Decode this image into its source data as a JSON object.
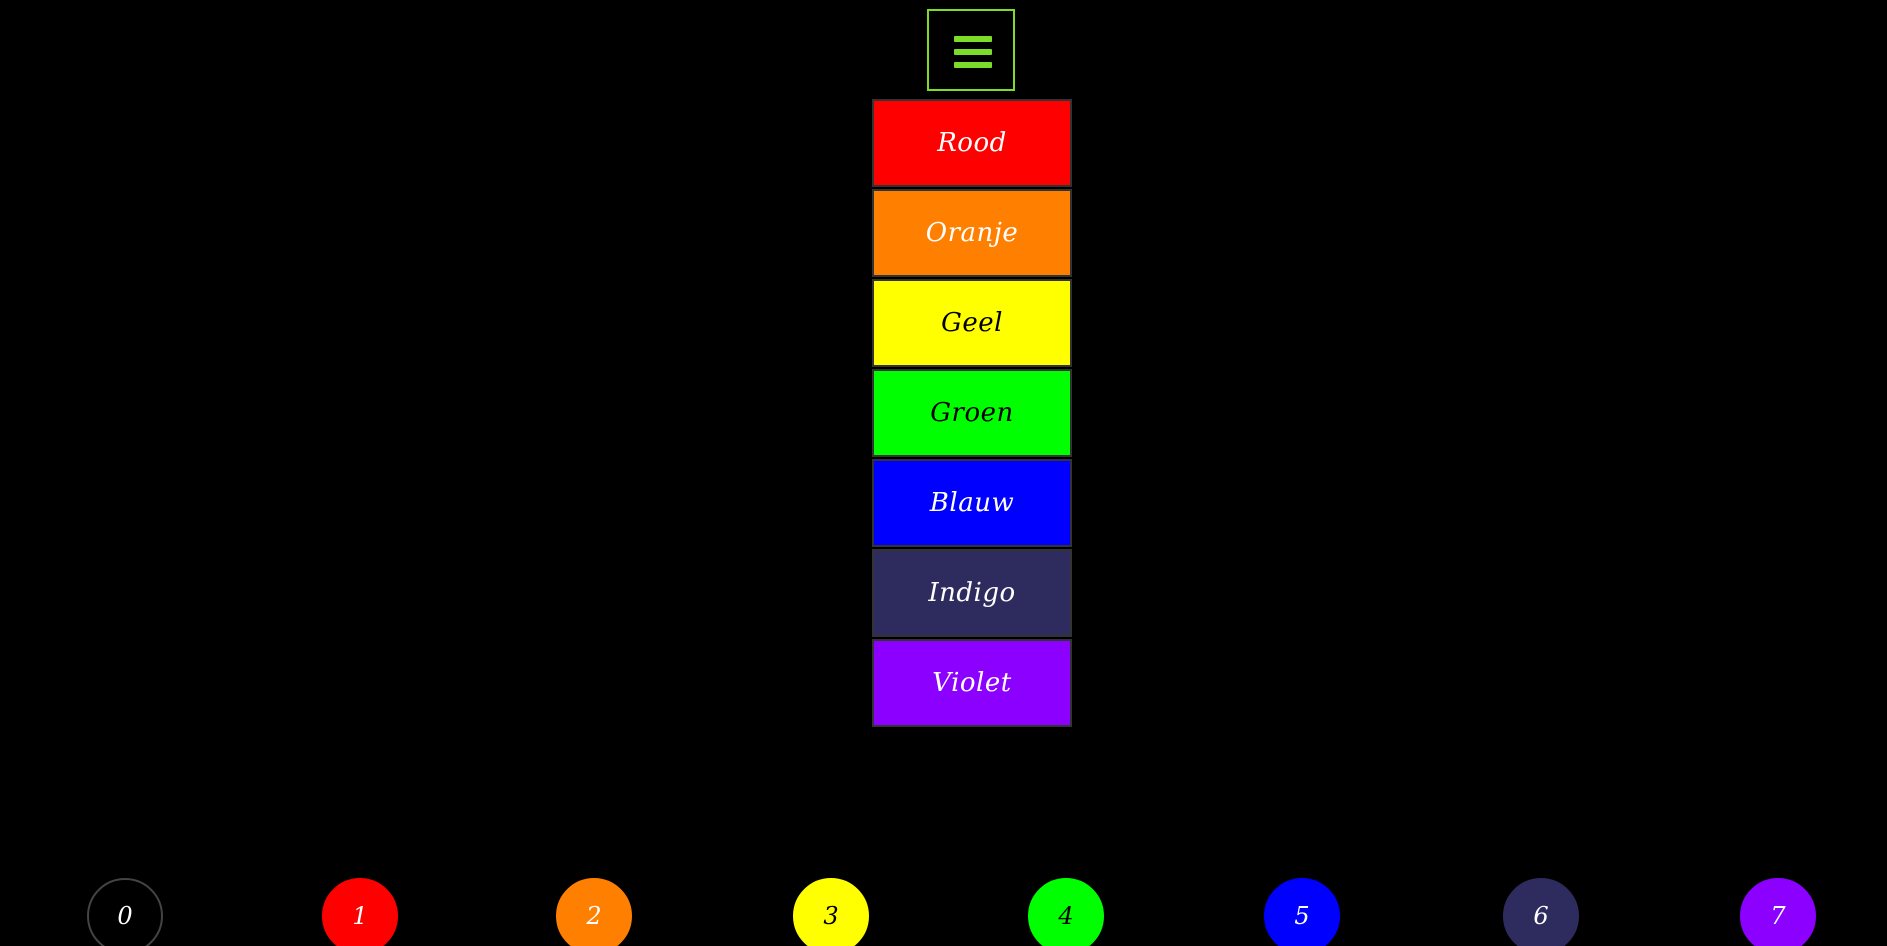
{
  "menu": {
    "icon": "hamburger-menu-icon",
    "color": "#7cdc2a"
  },
  "colors": [
    {
      "label": "Rood",
      "bg": "#ff0000",
      "fg": "#ffffff"
    },
    {
      "label": "Oranje",
      "bg": "#ff8000",
      "fg": "#ffffff"
    },
    {
      "label": "Geel",
      "bg": "#ffff00",
      "fg": "#000000"
    },
    {
      "label": "Groen",
      "bg": "#00ff00",
      "fg": "#000000"
    },
    {
      "label": "Blauw",
      "bg": "#0000ff",
      "fg": "#ffffff"
    },
    {
      "label": "Indigo",
      "bg": "#2e2b5f",
      "fg": "#ffffff"
    },
    {
      "label": "Violet",
      "bg": "#8b00ff",
      "fg": "#ffffff"
    }
  ],
  "circles": [
    {
      "label": "0",
      "bg": "#000000",
      "fg": "#ffffff",
      "border": "#444444"
    },
    {
      "label": "1",
      "bg": "#ff0000",
      "fg": "#ffffff",
      "border": "#ff0000"
    },
    {
      "label": "2",
      "bg": "#ff8000",
      "fg": "#ffffff",
      "border": "#ff8000"
    },
    {
      "label": "3",
      "bg": "#ffff00",
      "fg": "#000000",
      "border": "#ffff00"
    },
    {
      "label": "4",
      "bg": "#00ff00",
      "fg": "#000000",
      "border": "#00ff00"
    },
    {
      "label": "5",
      "bg": "#0000ff",
      "fg": "#ffffff",
      "border": "#0000ff"
    },
    {
      "label": "6",
      "bg": "#2e2b5f",
      "fg": "#ffffff",
      "border": "#2e2b5f"
    },
    {
      "label": "7",
      "bg": "#8b00ff",
      "fg": "#ffffff",
      "border": "#8b00ff"
    }
  ]
}
